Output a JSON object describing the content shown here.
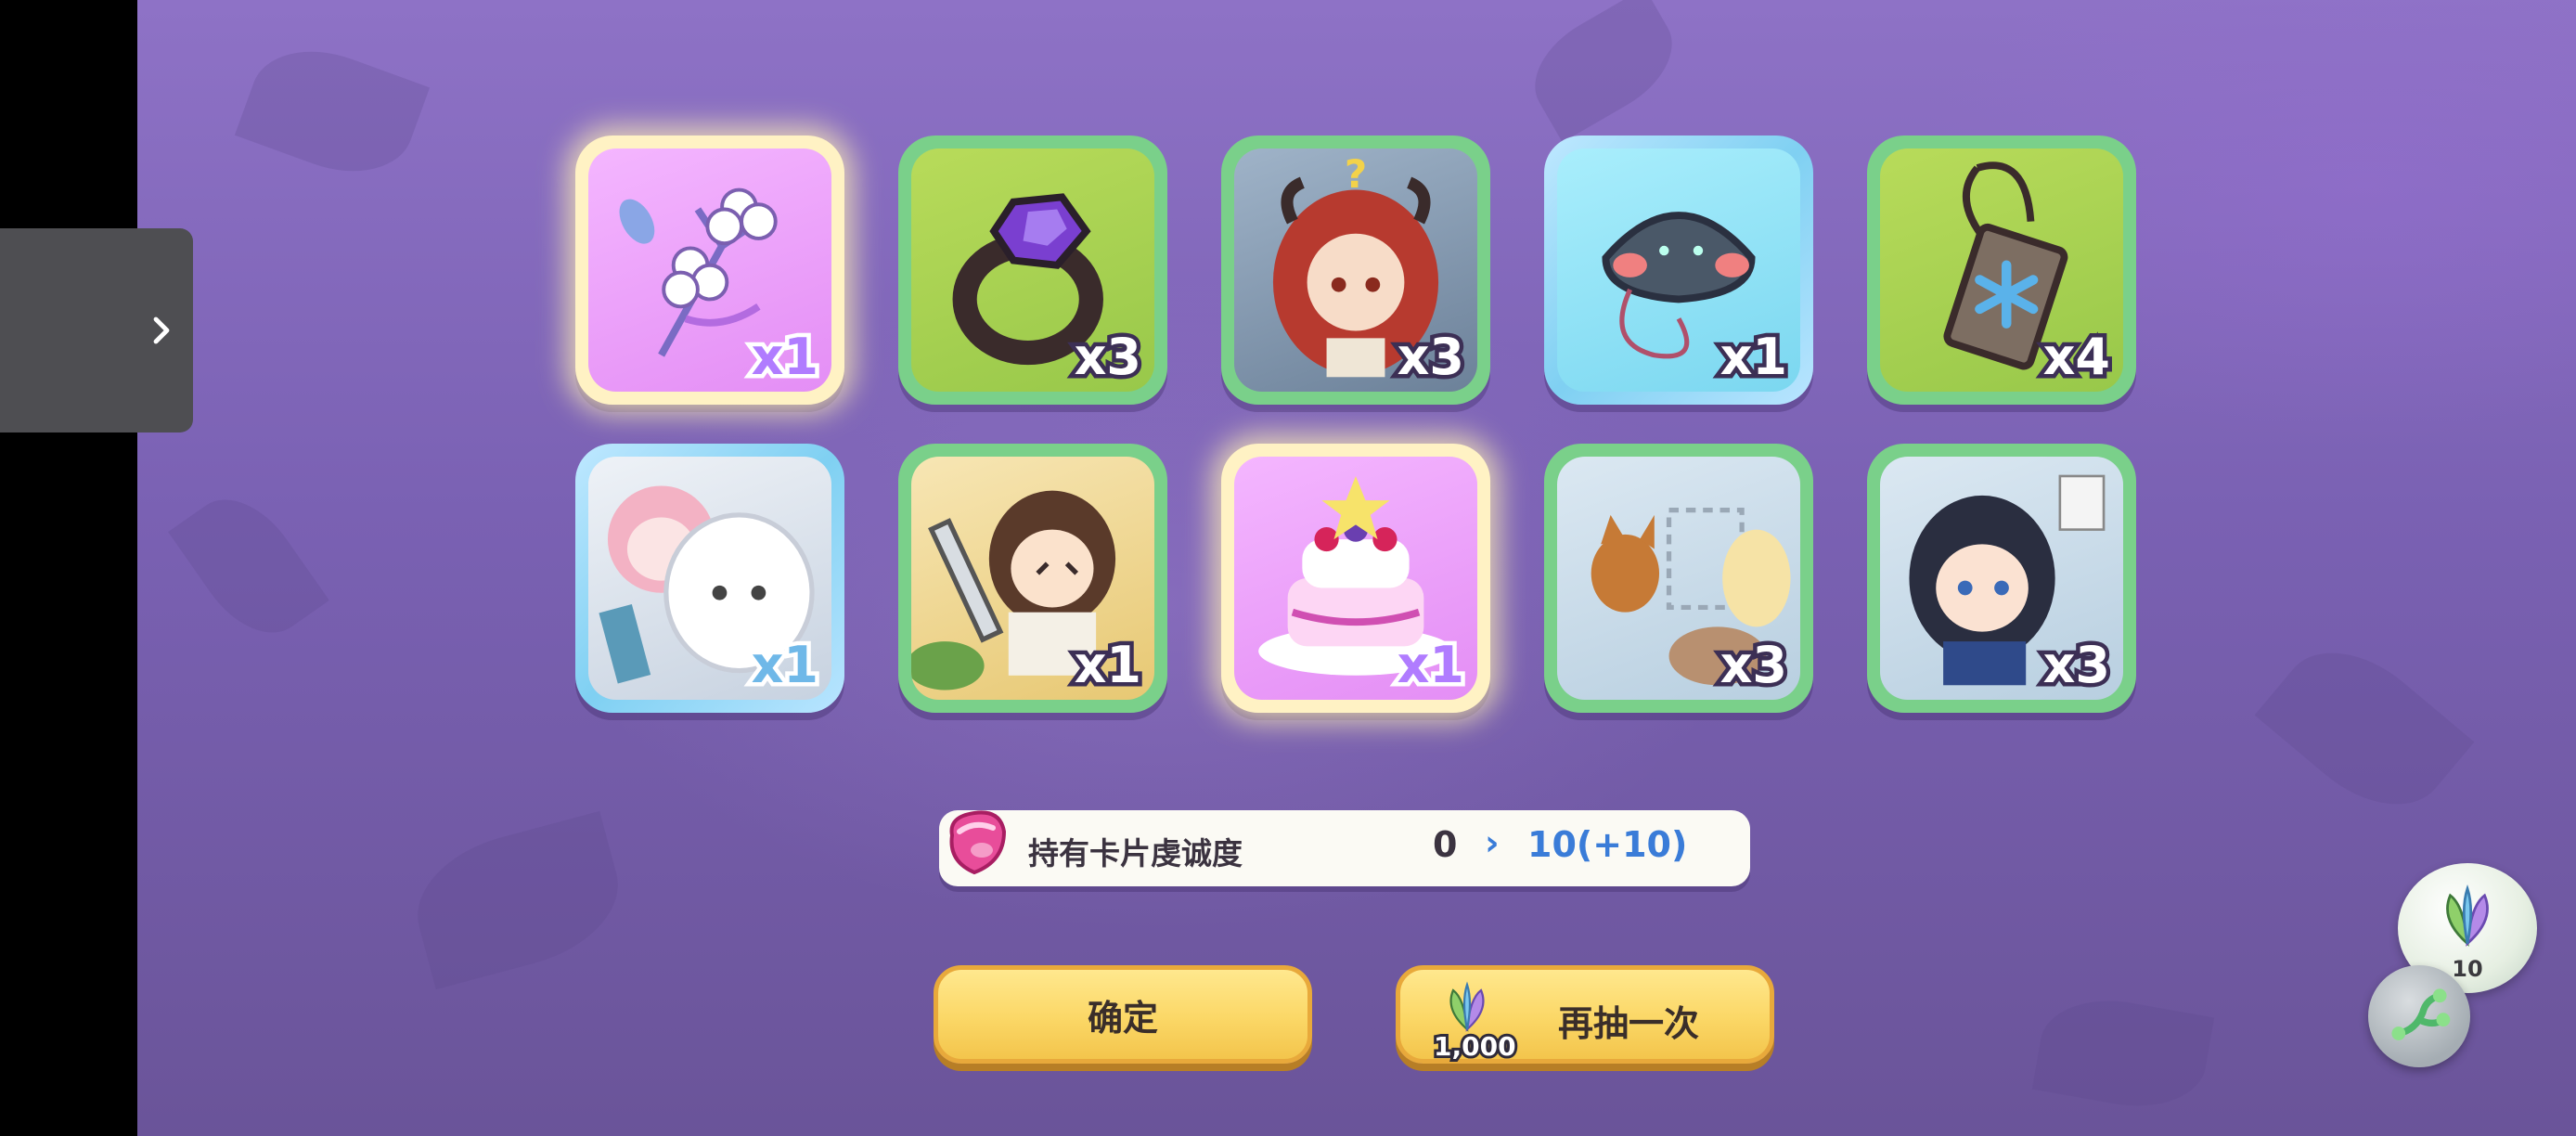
{
  "rewards": {
    "row1": [
      {
        "name": "sakura-bouquet",
        "qty": "x1"
      },
      {
        "name": "dark-ring",
        "qty": "x3"
      },
      {
        "name": "red-haired-girl-card",
        "qty": "x3"
      },
      {
        "name": "blob-charm",
        "qty": "x1"
      },
      {
        "name": "snowflake-tag",
        "qty": "x4"
      }
    ],
    "row2": [
      {
        "name": "two-girls-card",
        "qty": "x1"
      },
      {
        "name": "knight-girl-card",
        "qty": "x1"
      },
      {
        "name": "cake",
        "qty": "x1"
      },
      {
        "name": "fox-card",
        "qty": "x3"
      },
      {
        "name": "dark-haired-girl-card",
        "qty": "x3"
      }
    ]
  },
  "loyalty": {
    "label": "持有卡片虔诚度",
    "from": "0",
    "arrow": "›",
    "to": "10(+10)"
  },
  "buttons": {
    "confirm": "确定",
    "redraw": "再抽一次",
    "redraw_cost": "1,000"
  },
  "currency": {
    "count": "10"
  },
  "colors": {
    "accent_blue": "#3a7cd8",
    "button_yellow": "#fbd766",
    "card_green": "#7ad08a"
  }
}
